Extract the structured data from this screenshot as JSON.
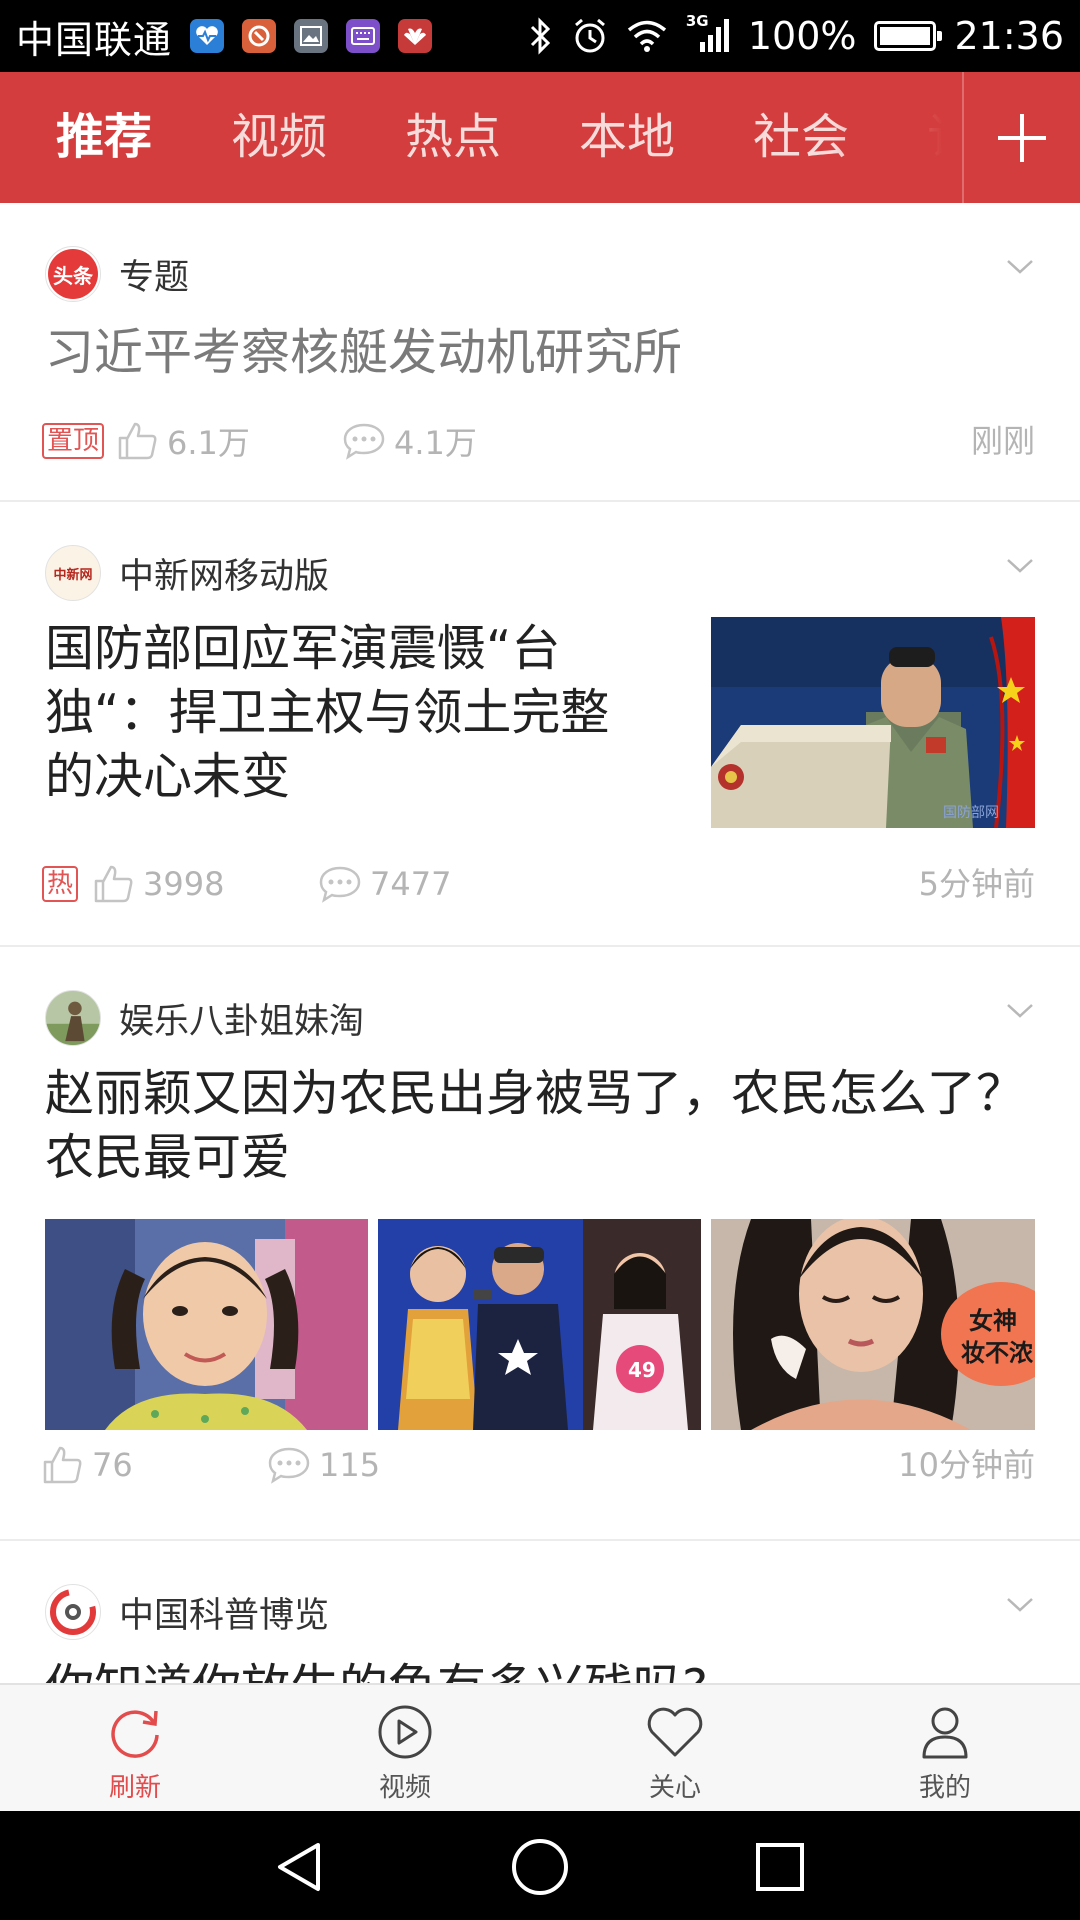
{
  "status_bar": {
    "carrier": "中国联通",
    "notification_icons": [
      "health-icon",
      "app-icon",
      "gallery-icon",
      "keyboard-icon",
      "huawei-icon"
    ],
    "network_type": "3G",
    "battery": "100%",
    "battery_level": 1.0,
    "time": "21:36"
  },
  "tabs": {
    "items": [
      "推荐",
      "视频",
      "热点",
      "本地",
      "社会",
      "订阅"
    ],
    "active": "推荐"
  },
  "feed": {
    "card1": {
      "source": "专题",
      "avatar_text": "头条",
      "title": "习近平考察核艇发动机研究所",
      "tag": "置顶",
      "likes": "6.1万",
      "comments": "4.1万",
      "time": "刚刚"
    },
    "card2": {
      "source": "中新网移动版",
      "avatar_text": "中新网",
      "title": "国防部回应军演震慑“台独“：捍卫主权与领土完整的决心未变",
      "tag": "热",
      "likes": "3998",
      "comments": "7477",
      "time": "5分钟前",
      "image_watermark": "国防部网"
    },
    "card3": {
      "source": "娱乐八卦姐妹淘",
      "title": "赵丽颖又因为农民出身被骂了，农民怎么了？农民最可爱",
      "likes": "76",
      "comments": "115",
      "time": "10分钟前",
      "image2_badge": "49",
      "image3_caption": "女神\n妆不浓"
    },
    "card4": {
      "source": "中国科普博览",
      "title_partial": "你知道你放生的龟有多兴残吗?"
    }
  },
  "bottom_nav": {
    "items": [
      "刷新",
      "视频",
      "关心",
      "我的"
    ],
    "active": "刷新"
  },
  "colors": {
    "brand_red": "#d43d3d",
    "accent_red": "#e24c4c",
    "meta_gray": "#b4b4b4"
  }
}
